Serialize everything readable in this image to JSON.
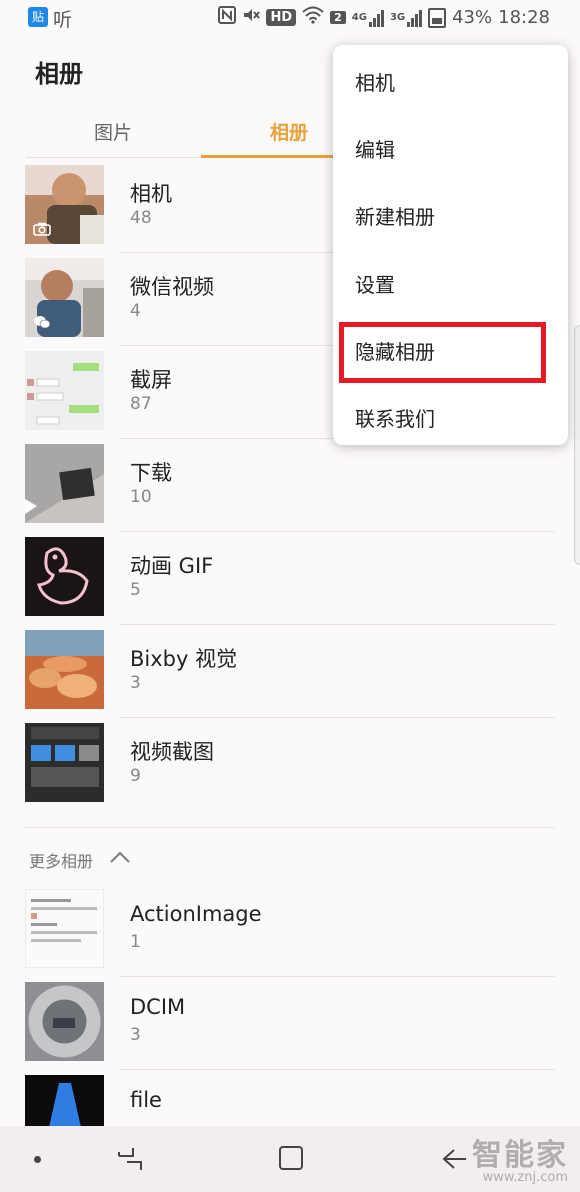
{
  "status_bar": {
    "app_icon_text": "贴",
    "app_text": "听",
    "hd": "HD",
    "sim_badge": "2",
    "network_1": "4G",
    "network_2": "3G",
    "battery": "43%",
    "time": "18:28"
  },
  "header": {
    "title": "相册"
  },
  "tabs": [
    {
      "label": "图片",
      "active": false
    },
    {
      "label": "相册",
      "active": true
    }
  ],
  "accent_color": "#e8a23c",
  "albums": [
    {
      "name": "相机",
      "count": "48",
      "overlay_icon": "camera-icon"
    },
    {
      "name": "微信视频",
      "count": "4",
      "overlay_icon": "wechat-icon"
    },
    {
      "name": "截屏",
      "count": "87"
    },
    {
      "name": "下载",
      "count": "10"
    },
    {
      "name": "动画 GIF",
      "count": "5"
    },
    {
      "name": "Bixby 视觉",
      "count": "3"
    },
    {
      "name": "视频截图",
      "count": "9"
    }
  ],
  "more_albums": {
    "label": "更多相册",
    "items": [
      {
        "name": "ActionImage",
        "count": "1"
      },
      {
        "name": "DCIM",
        "count": "3"
      },
      {
        "name": "file",
        "count": ""
      }
    ]
  },
  "menu": {
    "items": [
      "相机",
      "编辑",
      "新建相册",
      "设置",
      "隐藏相册",
      "联系我们"
    ],
    "highlighted_index": 4,
    "highlight_color": "#e41b23"
  },
  "watermark": {
    "title": "智能家",
    "url": "www.znj.com"
  }
}
